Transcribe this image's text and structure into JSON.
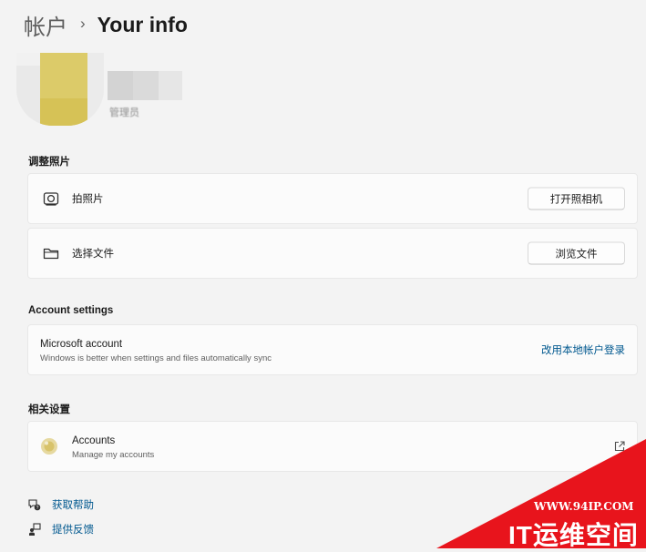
{
  "breadcrumb": {
    "parent": "帐户",
    "separator": "›",
    "current": "Your info"
  },
  "profile": {
    "role": "管理员"
  },
  "adjust_photo": {
    "title": "调整照片",
    "take_photo": {
      "label": "拍照片",
      "button": "打开照相机",
      "icon": "camera-icon"
    },
    "choose_file": {
      "label": "选择文件",
      "button": "浏览文件",
      "icon": "folder-icon"
    }
  },
  "account_settings": {
    "title": "Account settings",
    "microsoft_account": {
      "title": "Microsoft account",
      "subtitle": "Windows is better when settings and files automatically sync",
      "link": "改用本地帐户登录"
    }
  },
  "related": {
    "title": "相关设置",
    "accounts": {
      "title": "Accounts",
      "subtitle": "Manage my accounts",
      "icon": "external-link-icon"
    }
  },
  "help": {
    "get_help": "获取帮助",
    "feedback": "提供反馈"
  },
  "watermark": {
    "url": "WWW.94IP.COM",
    "text": "IT运维空间"
  },
  "colors": {
    "accent": "#00588f",
    "background": "#f3f3f3",
    "card": "#fbfbfb",
    "watermark": "#e8141c"
  }
}
